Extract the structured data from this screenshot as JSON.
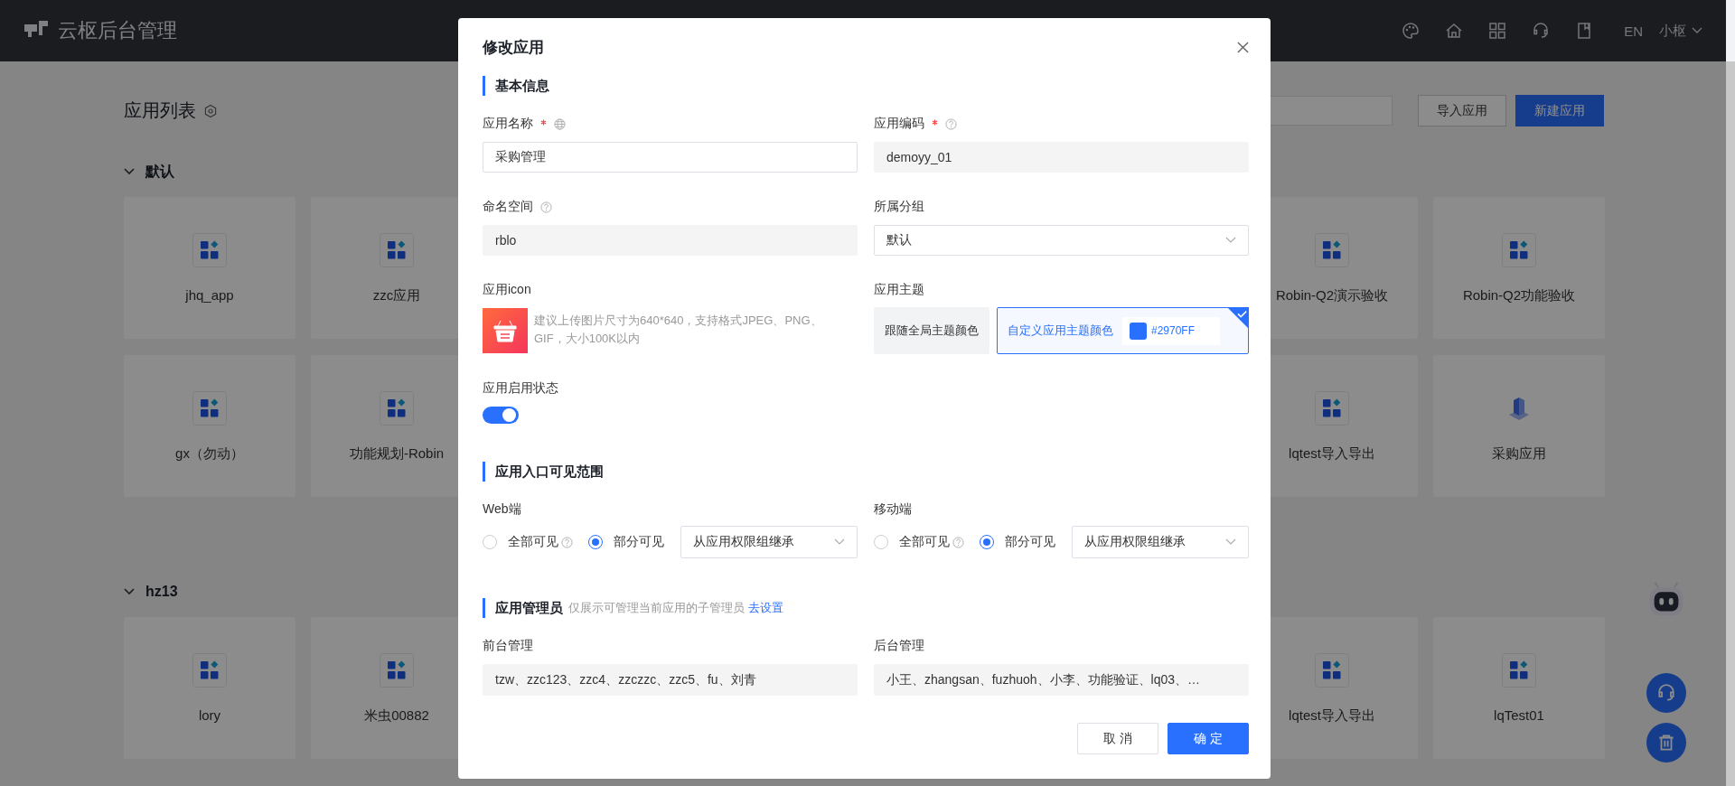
{
  "header": {
    "title": "云枢后台管理",
    "language": "EN",
    "user": "小枢"
  },
  "page": {
    "title": "应用列表",
    "buttons": [
      {
        "label": "导入应用",
        "kind": "default"
      },
      {
        "label": "新建应用",
        "kind": "primary"
      }
    ],
    "groups": [
      {
        "name": "默认",
        "expanded": true,
        "rows": [
          [
            {
              "label": "jhq_app",
              "kind": "default"
            },
            {
              "label": "zzc应用",
              "kind": "default"
            },
            {
              "label": "Robin-Q2演示验收",
              "kind": "default"
            },
            {
              "label": "Robin-Q2功能验收",
              "kind": "default"
            }
          ],
          [
            {
              "label": "gx（勿动）",
              "kind": "default"
            },
            {
              "label": "功能规划-Robin",
              "kind": "default"
            },
            {
              "label": "lqtest导入导出",
              "kind": "default"
            },
            {
              "label": "采购应用",
              "kind": "custom"
            }
          ]
        ]
      },
      {
        "name": "hz13",
        "expanded": true,
        "rows": [
          [
            {
              "label": "lory",
              "kind": "default"
            },
            {
              "label": "米虫00882",
              "kind": "default"
            },
            {
              "label": "lqtest导入导出",
              "kind": "default"
            },
            {
              "label": "lqTest01",
              "kind": "default"
            }
          ]
        ]
      }
    ]
  },
  "dialog": {
    "title": "修改应用",
    "basic": {
      "heading": "基本信息",
      "fields": [
        {
          "label": "应用名称",
          "required": true,
          "value": "采购管理",
          "disabled": false,
          "kind": "input"
        },
        {
          "label": "应用编码",
          "required": true,
          "value": "demoyy_01",
          "disabled": true,
          "kind": "input"
        },
        {
          "label": "命名空间",
          "required": false,
          "value": "rblo",
          "disabled": true,
          "kind": "input"
        },
        {
          "label": "所属分组",
          "required": false,
          "value": "默认",
          "disabled": false,
          "kind": "select"
        }
      ],
      "icon": {
        "label": "应用icon",
        "hint": "建议上传图片尺寸为640*640，支持格式JPEG、PNG、GIF，大小100K以内"
      },
      "theme": {
        "label": "应用主题",
        "options": [
          {
            "label": "跟随全局主题颜色",
            "selected": false
          },
          {
            "label": "自定义应用主题颜色",
            "selected": true,
            "value": "#2970FF",
            "color": "#2970ff"
          }
        ]
      },
      "status": {
        "label": "应用启用状态",
        "on": true
      }
    },
    "visibility": {
      "heading": "应用入口可见范围",
      "channels": [
        {
          "label": "Web端",
          "options": [
            {
              "label": "全部可见",
              "selected": false
            },
            {
              "label": "部分可见",
              "selected": true
            }
          ],
          "source": "从应用权限组继承"
        },
        {
          "label": "移动端",
          "options": [
            {
              "label": "全部可见",
              "selected": false
            },
            {
              "label": "部分可见",
              "selected": true
            }
          ],
          "source": "从应用权限组继承"
        }
      ]
    },
    "admins": {
      "heading": "应用管理员",
      "note": "仅展示可管理当前应用的子管理员",
      "link": "去设置",
      "fields": [
        {
          "label": "前台管理",
          "value": "tzw、zzc123、zzc4、zzczzc、zzc5、fu、刘青"
        },
        {
          "label": "后台管理",
          "value": "小王、zhangsan、fuzhuoh、小李、功能验证、lq03、…"
        }
      ]
    },
    "buttons": [
      {
        "label": "取 消",
        "kind": "default"
      },
      {
        "label": "确 定",
        "kind": "primary"
      }
    ]
  }
}
